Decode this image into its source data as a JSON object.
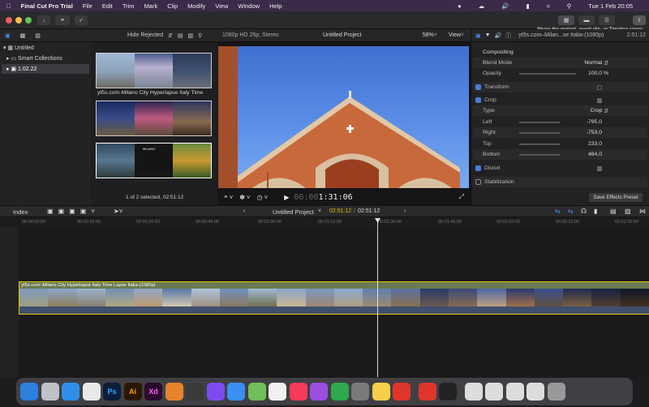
{
  "menubar": {
    "app": "Final Cut Pro Trial",
    "items": [
      "File",
      "Edit",
      "Trim",
      "Mark",
      "Clip",
      "Modify",
      "View",
      "Window",
      "Help"
    ],
    "datetime": "Tue 1 Feb  20:05"
  },
  "tooltip": "Share the project, event clip, or Timeline range",
  "browser": {
    "filter": "Hide Rejected",
    "library": "Untitled",
    "smart": "Smart Collections",
    "event": "1.02.22",
    "clip_title": "yt5s.com-Milano City Hyperlapse Italy Time",
    "status": "1 of 2 selected, 02:51:12",
    "overlay_text": "MILANO"
  },
  "viewer": {
    "format": "1080p HD 25p, Stereo",
    "project": "Untitled Project",
    "zoom": "58%",
    "view": "View",
    "timecode": "1:31:06",
    "timecode_prefix": "00:00"
  },
  "inspector": {
    "clip": "yt5s.com–Milan...se Italia-(1080p)",
    "duration": "2:51:12",
    "compositing": "Compositing",
    "blend_label": "Blend Mode",
    "blend": "Normal",
    "opacity_label": "Opacity",
    "opacity": "100,0 %",
    "transform": "Transform",
    "crop": "Crop",
    "type_label": "Type",
    "type": "Crop",
    "left_label": "Left",
    "left": "-795,0",
    "right_label": "Right",
    "right": "-753,0",
    "top_label": "Top",
    "top": "233,0",
    "bottom_label": "Bottom",
    "bottom": "484,0",
    "distort": "Distort",
    "stabilization": "Stabilization",
    "save": "Save Effects Preset"
  },
  "timeline": {
    "index": "Index",
    "project": "Untitled Project",
    "position": "02:51:12",
    "duration": "02:51:12",
    "ruler": [
      "00:00:00:00",
      "00:00:15:00",
      "00:00:30:00",
      "00:00:45:00",
      "00:01:00:00",
      "00:01:15:00",
      "00:01:30:00",
      "00:01:45:00",
      "00:02:00:00",
      "00:02:15:00",
      "00:02:30:00"
    ],
    "clip_label": "yt5s.com–Milano City Hyperlapse Italy Time Lapse Italia-(1080p)"
  },
  "dock": [
    {
      "name": "finder",
      "c": "#2d7fe0",
      "t": ""
    },
    {
      "name": "launchpad",
      "c": "#c0c0c8",
      "t": ""
    },
    {
      "name": "safari",
      "c": "#2f8fe8",
      "t": ""
    },
    {
      "name": "chrome",
      "c": "#e8e8e8",
      "t": ""
    },
    {
      "name": "photoshop",
      "c": "#0b1f3a",
      "t": "Ps"
    },
    {
      "name": "illustrator",
      "c": "#2a1700",
      "t": "Ai"
    },
    {
      "name": "xd",
      "c": "#2b0a2e",
      "t": "Xd"
    },
    {
      "name": "blender",
      "c": "#e6832b",
      "t": ""
    },
    {
      "name": "pen-tool",
      "c": "#3a3a3a",
      "t": ""
    },
    {
      "name": "messenger",
      "c": "#7b4cf0",
      "t": ""
    },
    {
      "name": "mail",
      "c": "#3a8ff0",
      "t": ""
    },
    {
      "name": "maps",
      "c": "#6fbf5a",
      "t": ""
    },
    {
      "name": "photos",
      "c": "#f0f0f0",
      "t": ""
    },
    {
      "name": "music",
      "c": "#f53b57",
      "t": ""
    },
    {
      "name": "podcasts",
      "c": "#9b4ee0",
      "t": ""
    },
    {
      "name": "numbers",
      "c": "#2fa84f",
      "t": ""
    },
    {
      "name": "system-prefs",
      "c": "#7a7a7a",
      "t": ""
    },
    {
      "name": "notes",
      "c": "#f5d04a",
      "t": ""
    },
    {
      "name": "anydesk-1",
      "c": "#e0352b",
      "t": ""
    },
    {
      "name": "anydesk-2",
      "c": "#e0352b",
      "t": ""
    },
    {
      "name": "final-cut",
      "c": "#222",
      "t": ""
    },
    {
      "name": "preview-1",
      "c": "#ddd",
      "t": ""
    },
    {
      "name": "preview-2",
      "c": "#ddd",
      "t": ""
    },
    {
      "name": "preview-3",
      "c": "#ddd",
      "t": ""
    },
    {
      "name": "preview-4",
      "c": "#ddd",
      "t": ""
    },
    {
      "name": "trash",
      "c": "#999",
      "t": ""
    }
  ]
}
